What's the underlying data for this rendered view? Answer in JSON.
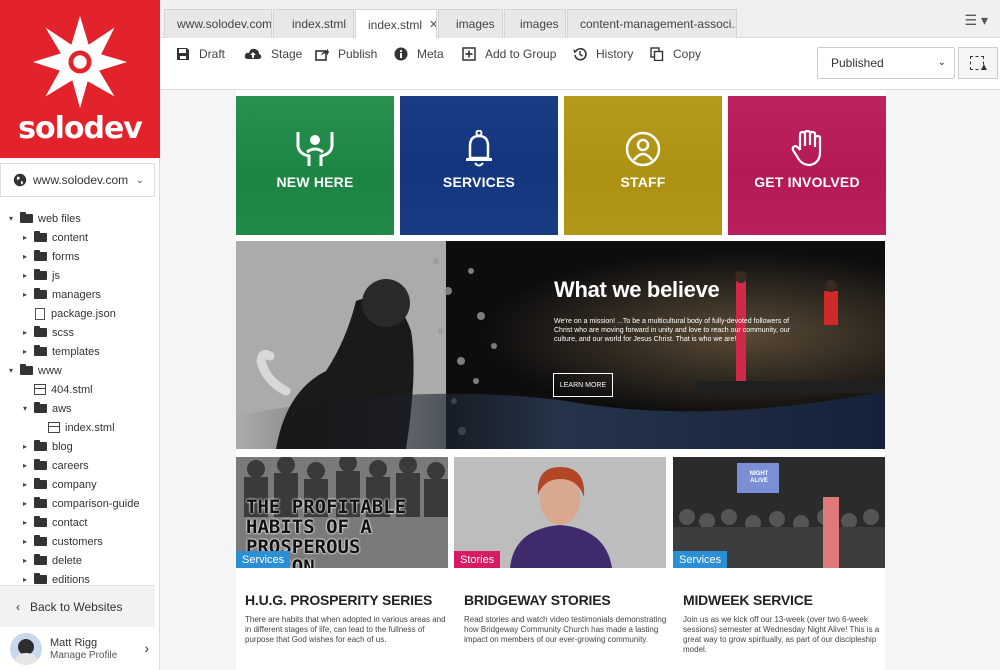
{
  "brand": {
    "name": "solodev",
    "color": "#e3232b"
  },
  "sidebar": {
    "site_selector": "www.solodev.com",
    "tree": [
      {
        "label": "web files",
        "type": "folder",
        "expanded": true,
        "depth": 0
      },
      {
        "label": "content",
        "type": "folder",
        "depth": 1
      },
      {
        "label": "forms",
        "type": "folder",
        "depth": 1
      },
      {
        "label": "js",
        "type": "folder",
        "depth": 1
      },
      {
        "label": "managers",
        "type": "folder",
        "depth": 1
      },
      {
        "label": "package.json",
        "type": "file",
        "depth": 1
      },
      {
        "label": "scss",
        "type": "folder",
        "depth": 1
      },
      {
        "label": "templates",
        "type": "folder",
        "depth": 1
      },
      {
        "label": "www",
        "type": "folder",
        "expanded": true,
        "depth": 0
      },
      {
        "label": "404.stml",
        "type": "page",
        "depth": 1
      },
      {
        "label": "aws",
        "type": "folder",
        "expanded": true,
        "depth": 1
      },
      {
        "label": "index.stml",
        "type": "page",
        "depth": 2
      },
      {
        "label": "blog",
        "type": "folder",
        "depth": 1
      },
      {
        "label": "careers",
        "type": "folder",
        "depth": 1
      },
      {
        "label": "company",
        "type": "folder",
        "depth": 1
      },
      {
        "label": "comparison-guide",
        "type": "folder",
        "depth": 1
      },
      {
        "label": "contact",
        "type": "folder",
        "depth": 1
      },
      {
        "label": "customers",
        "type": "folder",
        "depth": 1
      },
      {
        "label": "delete",
        "type": "folder",
        "depth": 1
      },
      {
        "label": "editions",
        "type": "folder",
        "depth": 1
      }
    ],
    "back_label": "Back to Websites",
    "user": {
      "name": "Matt Rigg",
      "sub": "Manage Profile"
    }
  },
  "tabs": [
    {
      "label": "www.solodev.com",
      "active": false
    },
    {
      "label": "index.stml",
      "active": false
    },
    {
      "label": "index.stml",
      "active": true
    },
    {
      "label": "images",
      "active": false
    },
    {
      "label": "images",
      "active": false
    },
    {
      "label": "content-management-associ...",
      "active": false
    }
  ],
  "toolbar": {
    "items": [
      {
        "label": "Draft",
        "icon": "save-icon"
      },
      {
        "label": "Stage",
        "icon": "cloud-upload-icon"
      },
      {
        "label": "Publish",
        "icon": "share-icon"
      },
      {
        "label": "Meta",
        "icon": "info-icon"
      },
      {
        "label": "Add to Group",
        "icon": "plus-square-icon"
      },
      {
        "label": "History",
        "icon": "history-icon"
      },
      {
        "label": "Copy",
        "icon": "copy-icon"
      }
    ],
    "status": "Published"
  },
  "preview": {
    "tiles": [
      {
        "label": "NEW HERE",
        "color": "#1a9a4a",
        "icon": "raised-hands-icon"
      },
      {
        "label": "SERVICES",
        "color": "#123d95",
        "icon": "bell-icon"
      },
      {
        "label": "STAFF",
        "color": "#c9a80e",
        "icon": "person-circle-icon"
      },
      {
        "label": "GET INVOLVED",
        "color": "#d61a64",
        "icon": "raised-hand-icon"
      }
    ],
    "hero": {
      "title": "What we believe",
      "body": "We're on a mission! ...To be a multicultural body of fully-devoted followers of Christ who are moving forward in unity and love to reach our community, our culture, and our world for Jesus Christ. That is who we are!",
      "button": "LEARN MORE"
    },
    "cards": [
      {
        "tag": "Services",
        "tag_color": "#2b8fd6",
        "title": "H.U.G. PROSPERITY SERIES",
        "body": "There are habits that when adopted in various areas and in different stages of life, can lead to the fullness of purpose that God wishes for each of us.",
        "image_text": "THE PROFITABLE HABITS OF A PROSPEROUS PERSON"
      },
      {
        "tag": "Stories",
        "tag_color": "#d61a64",
        "title": "BRIDGEWAY STORIES",
        "body": "Read stories and watch video testimonials demonstrating how Bridgeway Community Church has made a lasting impact on members of our ever-growing community."
      },
      {
        "tag": "Services",
        "tag_color": "#2b8fd6",
        "title": "MIDWEEK SERVICE",
        "body": "Join us as we kick off our 13-week (over two 6-week sessions) semester at Wednesday Night Alive! This is a great way to grow spiritually, as part of our discipleship model.",
        "image_text": "NIGHT ALIVE"
      }
    ]
  }
}
